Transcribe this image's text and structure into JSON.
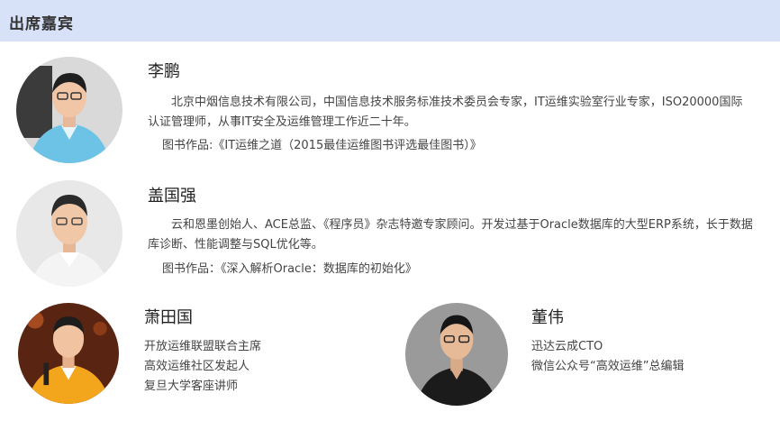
{
  "header": {
    "title": "出席嘉宾"
  },
  "guests": [
    {
      "name": "李鹏",
      "bio": "北京中烟信息技术有限公司，中国信息技术服务标准技术委员会专家，IT运维实验室行业专家，ISO20000国际认证管理师，从事IT安全及运维管理工作近二十年。",
      "books_label": "图书作品:",
      "books_value": "《IT运维之道（2015最佳运维图书评选最佳图书）》"
    },
    {
      "name": "盖国强",
      "bio": "云和恩墨创始人、ACE总监、《程序员》杂志特邀专家顾问。开发过基于Oracle数据库的大型ERP系统，长于数据库诊断、性能调整与SQL优化等。",
      "books_label": "图书作品：",
      "books_value": "《深入解析Oracle：数据库的初始化》"
    },
    {
      "name": "萧田国",
      "lines": [
        "开放运维联盟联合主席",
        "高效运维社区发起人",
        "复旦大学客座讲师"
      ]
    },
    {
      "name": "董伟",
      "lines": [
        "迅达云成CTO",
        "微信公众号“高效运维”总编辑"
      ]
    }
  ]
}
